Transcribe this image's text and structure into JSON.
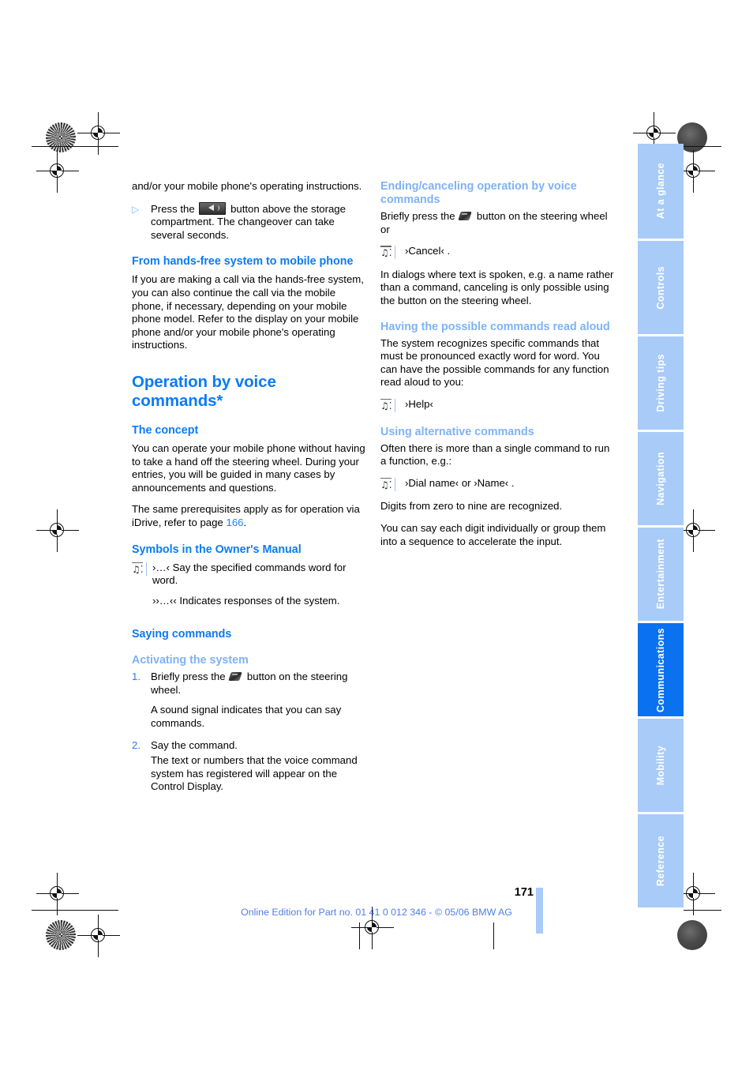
{
  "document": {
    "page_number": "171",
    "edition_line": "Online Edition for Part no. 01 41 0 012 346 - © 05/06 BMW AG"
  },
  "tabs": [
    {
      "label": "At a glance",
      "active": false
    },
    {
      "label": "Controls",
      "active": false
    },
    {
      "label": "Driving tips",
      "active": false
    },
    {
      "label": "Navigation",
      "active": false
    },
    {
      "label": "Entertainment",
      "active": false
    },
    {
      "label": "Communications",
      "active": true
    },
    {
      "label": "Mobility",
      "active": false
    },
    {
      "label": "Reference",
      "active": false
    }
  ],
  "colors": {
    "heading_blue": "#0b7bf5",
    "subheading_blue": "#7fb2f5",
    "tab_inactive": "#a9cbf7",
    "tab_active": "#0a72f0",
    "link_blue": "#2a7ef0",
    "footer_blue": "#4f7fe8"
  },
  "left_column": {
    "continued_paragraph": "and/or your mobile phone's operating instructions.",
    "bullet_item": {
      "before_icon": "Press the",
      "icon": "speaker-button-icon",
      "after_icon": "button above the storage compartment. The changeover can take several seconds."
    },
    "heading_handsfree": "From hands-free system to mobile phone",
    "handsfree_paragraph": "If you are making a call via the hands-free system, you can also continue the call via the mobile phone, if necessary, depending on your mobile phone model. Refer to the display on your mobile phone and/or your mobile phone's operating instructions.",
    "title": "Operation by voice commands*",
    "heading_concept": "The concept",
    "concept_paragraph_1": "You can operate your mobile phone without having to take a hand off the steering wheel. During your entries, you will be guided in many cases by announcements and questions.",
    "concept_paragraph_2_before": "The same prerequisites apply as for operation via iDrive, refer to page",
    "concept_paragraph_2_link": "166",
    "concept_paragraph_2_after": ".",
    "heading_symbols": "Symbols in the Owner's Manual",
    "symbol_say": "›…‹ Say the specified commands word for word.",
    "symbol_response": "››…‹‹ Indicates responses of the system.",
    "heading_saying": "Saying commands",
    "heading_activating": "Activating the system",
    "step_1_before": "Briefly press the",
    "step_1_icon": "steering-wheel-button-icon",
    "step_1_after": "button on the steering wheel.",
    "step_1_note": "A sound signal indicates that you can say commands.",
    "step_2": "Say the command.",
    "step_2_note": "The text or numbers that the voice command system has registered will appear on the Control Display."
  },
  "right_column": {
    "heading_ending": "Ending/canceling operation by voice commands",
    "ending_paragraph_before": "Briefly press the",
    "ending_icon": "steering-wheel-button-icon",
    "ending_paragraph_after": "button on the steering wheel or",
    "ending_command": "›Cancel‹ .",
    "ending_note": "In dialogs where text is spoken, e.g. a name rather than a command, canceling is only possible using the button on the steering wheel.",
    "heading_readaloud": "Having the possible commands read aloud",
    "readaloud_paragraph": "The system recognizes specific commands that must be pronounced exactly word for word. You can have the possible commands for any function read aloud to you:",
    "readaloud_command": "›Help‹",
    "heading_alternative": "Using alternative commands",
    "alternative_paragraph": "Often there is more than a single command to run a function, e.g.:",
    "alternative_command": "›Dial name‹ or ›Name‹ .",
    "alternative_note_1": "Digits from zero to nine are recognized.",
    "alternative_note_2": "You can say each digit individually or group them into a sequence to accelerate the input."
  }
}
